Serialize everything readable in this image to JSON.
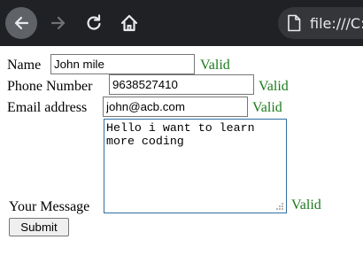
{
  "browser": {
    "address_text": "file:///C:",
    "colors": {
      "toolbar": "#202124",
      "address_bar": "#35363a",
      "back_hover": "#5f6368"
    },
    "icons": [
      "back-arrow-icon",
      "forward-arrow-icon",
      "reload-icon",
      "home-icon",
      "file-icon"
    ]
  },
  "form": {
    "name": {
      "label": "Name",
      "value": "John mile",
      "status": "Valid"
    },
    "phone": {
      "label": "Phone Number",
      "value": "9638527410",
      "status": "Valid"
    },
    "email": {
      "label": "Email address",
      "value": "john@acb.com",
      "status": "Valid"
    },
    "message": {
      "label": "Your Message",
      "value": "Hello i want to learn more coding",
      "status": "Valid"
    },
    "submit_label": "Submit",
    "valid_color": "#1a7a1a"
  }
}
